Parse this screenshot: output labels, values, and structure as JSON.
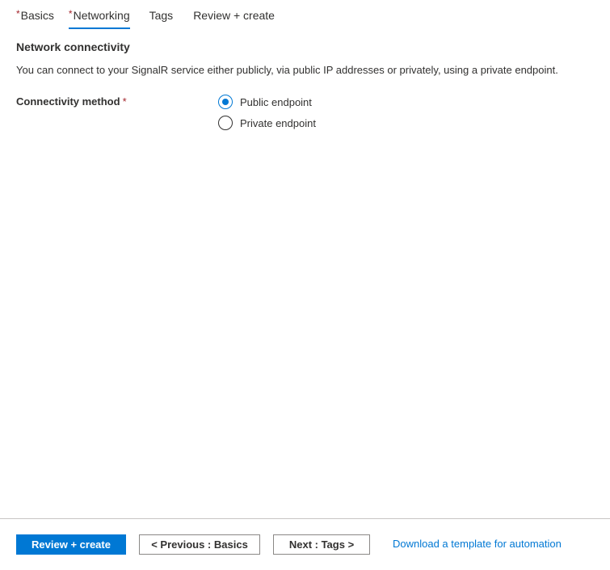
{
  "tabs": [
    {
      "label": "Basics",
      "required": "*",
      "active": false
    },
    {
      "label": "Networking",
      "required": "*",
      "active": true
    },
    {
      "label": "Tags",
      "required": "",
      "active": false
    },
    {
      "label": "Review + create",
      "required": "",
      "active": false
    }
  ],
  "section": {
    "title": "Network connectivity",
    "description": "You can connect to your SignalR service either publicly, via public IP addresses or privately, using a private endpoint."
  },
  "connectivity": {
    "label": "Connectivity method",
    "required_marker": "*",
    "options": [
      {
        "label": "Public endpoint",
        "selected": true
      },
      {
        "label": "Private endpoint",
        "selected": false
      }
    ]
  },
  "footer": {
    "review_create": "Review + create",
    "previous": "< Previous : Basics",
    "next": "Next : Tags >",
    "download_link": "Download a template for automation"
  },
  "colors": {
    "accent": "#0078d4",
    "required": "#a4262c",
    "text": "#323130"
  }
}
